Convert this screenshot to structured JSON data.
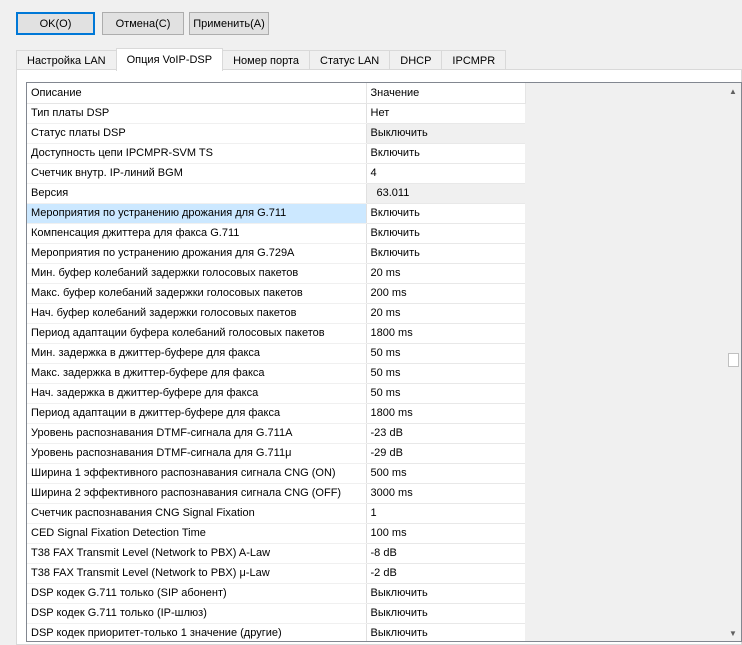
{
  "toolbar": {
    "ok_label": "OK(O)",
    "cancel_label": "Отмена(C)",
    "apply_label": "Применить(A)"
  },
  "tabs": [
    {
      "label": "Настройка LAN",
      "active": false
    },
    {
      "label": "Опция VoIP-DSP",
      "active": true
    },
    {
      "label": "Номер порта",
      "active": false
    },
    {
      "label": "Статус LAN",
      "active": false
    },
    {
      "label": "DHCP",
      "active": false
    },
    {
      "label": "IPCMPR",
      "active": false
    }
  ],
  "grid": {
    "columns": [
      "Описание",
      "Значение"
    ],
    "rows": [
      {
        "desc": "Тип платы DSP",
        "value": "Нет"
      },
      {
        "desc": "Статус платы DSP",
        "value": "Выключить",
        "readonly": true
      },
      {
        "desc": "Доступность цепи IPCMPR-SVM TS",
        "value": "Включить"
      },
      {
        "desc": "Счетчик внутр. IP-линий BGM",
        "value": "4"
      },
      {
        "desc": "Версия",
        "value": "63.011",
        "readonly": true
      },
      {
        "desc": "Мероприятия по устранению дрожания для G.711",
        "value": "Включить",
        "selected": true
      },
      {
        "desc": "Компенсация джиттера для факса G.711",
        "value": "Включить"
      },
      {
        "desc": "Мероприятия по устранению дрожания для G.729A",
        "value": "Включить"
      },
      {
        "desc": "Мин. буфер колебаний задержки голосовых пакетов",
        "value": "20 ms"
      },
      {
        "desc": "Макс. буфер колебаний задержки голосовых пакетов",
        "value": "200 ms"
      },
      {
        "desc": "Нач. буфер колебаний задержки голосовых пакетов",
        "value": "20 ms"
      },
      {
        "desc": "Период адаптации буфера колебаний голосовых пакетов",
        "value": "1800 ms"
      },
      {
        "desc": "Мин. задержка в джиттер-буфере для факса",
        "value": "50 ms"
      },
      {
        "desc": "Макс. задержка в джиттер-буфере для факса",
        "value": "50 ms"
      },
      {
        "desc": "Нач. задержка в джиттер-буфере для факса",
        "value": "50 ms"
      },
      {
        "desc": "Период адаптации в джиттер-буфере для факса",
        "value": "1800 ms"
      },
      {
        "desc": "Уровень распознавания DTMF-сигнала для G.711A",
        "value": "-23 dB"
      },
      {
        "desc": "Уровень распознавания DTMF-сигнала для G.711μ",
        "value": "-29 dB"
      },
      {
        "desc": "Ширина 1 эффективного распознавания сигнала CNG (ON)",
        "value": "500 ms"
      },
      {
        "desc": "Ширина 2 эффективного распознавания сигнала CNG (OFF)",
        "value": "3000 ms"
      },
      {
        "desc": "Счетчик распознавания CNG Signal Fixation",
        "value": "1"
      },
      {
        "desc": "CED Signal Fixation Detection Time",
        "value": "100 ms"
      },
      {
        "desc": "T38 FAX Transmit Level (Network to PBX) A-Law",
        "value": "-8 dB"
      },
      {
        "desc": "T38 FAX Transmit Level (Network to PBX) μ-Law",
        "value": "-2 dB"
      },
      {
        "desc": "DSP кодек G.711 только (SIP абонент)",
        "value": "Выключить"
      },
      {
        "desc": "DSP кодек  G.711 только (IP-шлюз)",
        "value": "Выключить"
      },
      {
        "desc": "DSP кодек  приоритет-только 1 значение (другие)",
        "value": "Выключить"
      }
    ]
  },
  "icons": {
    "scroll_up": "chevron-up-icon",
    "scroll_down": "chevron-down-icon"
  },
  "colors": {
    "selection": "#cce8ff",
    "default_button_border": "#0078d7",
    "readonly_cell": "#f0f0f0"
  }
}
